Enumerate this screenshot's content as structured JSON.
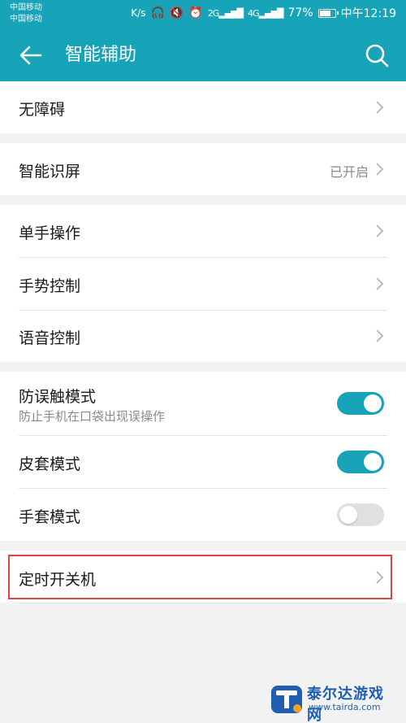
{
  "status_bar": {
    "carrier_1": "中国移动",
    "carrier_2": "中国移动",
    "net_speed": "K/s",
    "signal_1": "2G",
    "signal_2": "4G",
    "battery": "77%",
    "battery_level": 0.77,
    "time": "中午12:19"
  },
  "appbar": {
    "title": "智能辅助",
    "back_icon": "back-arrow-icon",
    "search_icon": "search-icon"
  },
  "items": {
    "accessibility": {
      "label": "无障碍"
    },
    "smart_screen": {
      "label": "智能识屏",
      "value": "已开启"
    },
    "one_hand": {
      "label": "单手操作"
    },
    "gesture": {
      "label": "手势控制"
    },
    "voice": {
      "label": "语音控制"
    },
    "pocket_mode": {
      "label": "防误触模式",
      "desc": "防止手机在口袋出现误操作",
      "enabled": true
    },
    "cover_mode": {
      "label": "皮套模式",
      "enabled": true
    },
    "glove_mode": {
      "label": "手套模式",
      "enabled": false
    },
    "scheduled_power": {
      "label": "定时开关机"
    }
  },
  "colors": {
    "accent": "#17a3b8",
    "highlight_border": "#e04343",
    "background": "#f2f2f2"
  }
}
